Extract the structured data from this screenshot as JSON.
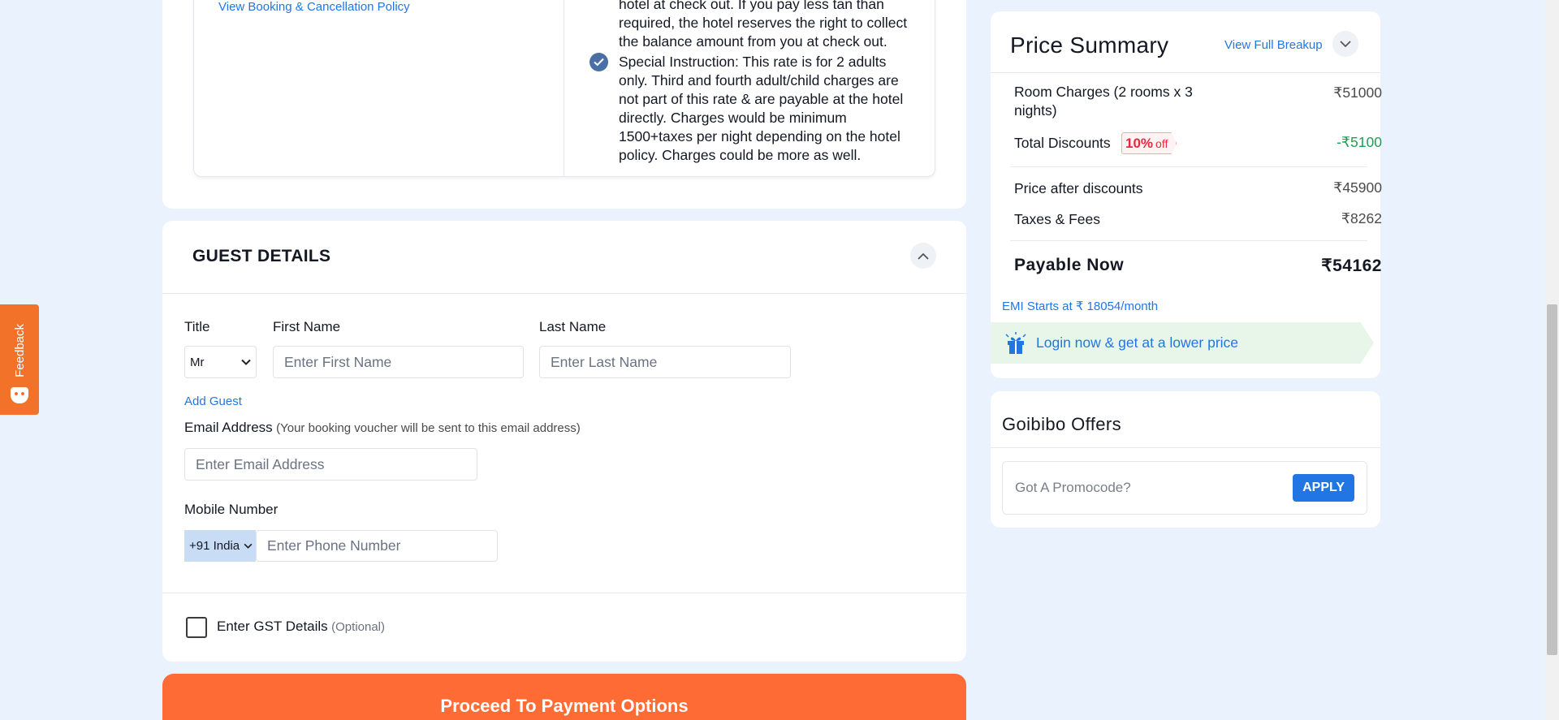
{
  "feedback": {
    "label": "Feedback"
  },
  "policy": {
    "link": "View Booking & Cancellation Policy",
    "bullet_partial": "hotel at check out. If you pay less tan than required, the hotel reserves the right to collect the balance amount from you at check out.",
    "bullet_partial_lines": [
      "hotel at check out. If you pay less tan than",
      "required, the hotel reserves the right to collect",
      "the balance amount from you at check out."
    ],
    "special_instruction_lines": [
      "Special Instruction: This rate is for 2 adults",
      "only. Third and fourth adult/child charges are",
      "not part of this rate & are payable at the hotel",
      "directly. Charges would be minimum",
      "1500+taxes per night depending on the hotel",
      "policy. Charges could be more as well."
    ]
  },
  "guest": {
    "title": "GUEST DETAILS",
    "title_label": "Title",
    "title_value": "Mr",
    "first_name_label": "First Name",
    "first_name_placeholder": "Enter First Name",
    "last_name_label": "Last Name",
    "last_name_placeholder": "Enter Last Name",
    "add_guest": "Add Guest",
    "email_label": "Email Address",
    "email_note": "(Your booking voucher will be sent to this email address)",
    "email_placeholder": "Enter Email Address",
    "mobile_label": "Mobile Number",
    "country_code": "+91 India",
    "phone_placeholder": "Enter Phone Number",
    "gst_label": "Enter GST Details",
    "gst_optional": "(Optional)"
  },
  "proceed_button": "Proceed To Payment Options",
  "price_summary": {
    "title": "Price Summary",
    "view_full_breakup": "View Full Breakup",
    "room_charges_lines": [
      "Room Charges (2 rooms x 3",
      "nights)"
    ],
    "room_charges_amount": "₹51000",
    "total_discounts_label": "Total Discounts",
    "discount_pct": "10%",
    "discount_off": "off",
    "total_discounts_amount": "-₹5100",
    "after_discount_label": "Price after discounts",
    "after_discount_amount": "₹45900",
    "taxes_label": "Taxes & Fees",
    "taxes_amount": "₹8262",
    "payable_label": "Payable Now",
    "payable_amount": "₹54162",
    "emi_text": "EMI Starts at ₹ 18054/month",
    "login_text": "Login now & get at a lower price"
  },
  "offers": {
    "title": "Goibibo Offers",
    "promo_placeholder": "Got A Promocode?",
    "apply": "APPLY"
  },
  "colors": {
    "brand_orange": "#fe6b35",
    "link_blue": "#2276e3",
    "discount_green": "#1f9d55",
    "discount_red": "#e5293d",
    "page_bg": "#e9f2fd"
  }
}
